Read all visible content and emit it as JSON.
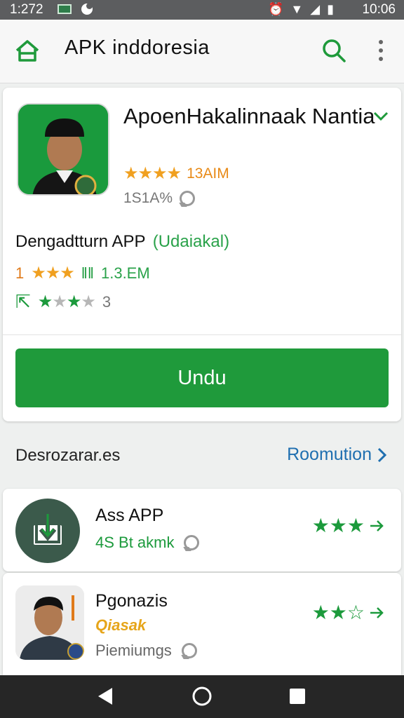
{
  "status_bar": {
    "time_left": "1:272",
    "time_right": "10:06"
  },
  "app_bar": {
    "title": "APK inddoresia"
  },
  "app": {
    "name": "ApoenHakalinnaak Nantia",
    "rating_text": "13AIM",
    "percent_text": "1S1A%",
    "subtitle": "Dengadtturn APP",
    "subtitle_tag": "(Udaiakal)",
    "row2_number": "1",
    "row2_size": "1.3.EM",
    "row3_count": "3",
    "download_label": "Undu",
    "stars": 3.5
  },
  "section": {
    "label": "Desrozarar.es",
    "more_label": "Roomution"
  },
  "list": [
    {
      "name": "Ass APP",
      "sub": "4S Bt akmk",
      "sub2": "",
      "stars": 3
    },
    {
      "name": "Pgonazis",
      "sub": "Qiasak",
      "sub2": "Piemiumgs",
      "stars": 2.5
    }
  ],
  "colors": {
    "accent_green": "#1f9a3b",
    "link_blue": "#1f6fb0",
    "rating_orange": "#e88a17"
  }
}
